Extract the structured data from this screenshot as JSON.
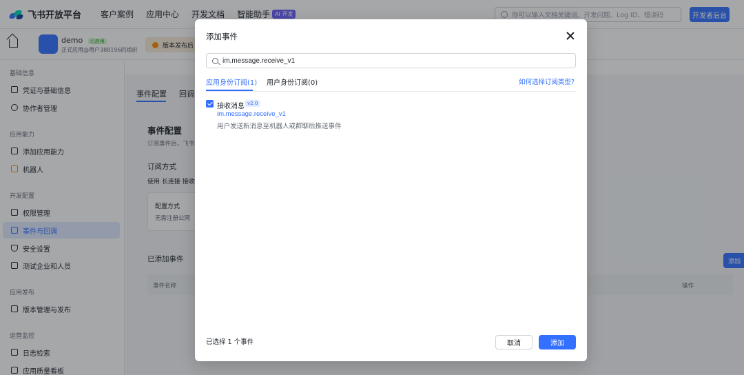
{
  "topnav": {
    "brand": "飞书开放平台",
    "items": [
      "客户案例",
      "应用中心",
      "开发文档",
      "智能助手"
    ],
    "ai_badge": "AI 开发",
    "search_placeholder": "你可以输入文档关键词、开发问题、Log ID、错误码",
    "dev_console": "开发者后台"
  },
  "subheader": {
    "app_name": "demo",
    "app_status": "已启用",
    "app_sub": "正式应用@用户388196的组织",
    "version_notice": "版本发布后"
  },
  "sidebar": {
    "groups": [
      {
        "label": "基础信息",
        "items": [
          "凭证与基础信息",
          "协作者管理"
        ]
      },
      {
        "label": "应用能力",
        "items": [
          "添加应用能力",
          "机器人"
        ]
      },
      {
        "label": "开发配置",
        "items": [
          "权限管理",
          "事件与回调",
          "安全设置",
          "测试企业和人员"
        ]
      },
      {
        "label": "应用发布",
        "items": [
          "版本管理与发布"
        ]
      },
      {
        "label": "运营监控",
        "items": [
          "日志检索",
          "应用质量看板"
        ]
      }
    ],
    "active_item": "事件与回调"
  },
  "main": {
    "tabs": [
      "事件配置",
      "回调"
    ],
    "section_title": "事件配置",
    "section_desc": "订阅事件后，飞书",
    "subscribe_label": "订阅方式",
    "subscribe_desc": "使用 长连接 接收",
    "config_label": "配置方式",
    "config_desc": "无需注册公网",
    "added_title": "已添加事件",
    "add_button": "添加",
    "col_name": "事件名称",
    "col_action": "操作"
  },
  "modal": {
    "title": "添加事件",
    "search_value": "im.message.receive_v1",
    "tabs": [
      "应用身份订阅(1)",
      "用户身份订阅(0)"
    ],
    "help_link": "如何选择订阅类型?",
    "event": {
      "name": "接收消息",
      "version": "v2.0",
      "key": "im.message.receive_v1",
      "description": "用户发送新消息至机器人或群聊后推送事件",
      "checked": true
    },
    "selected_text": "已选择 1 个事件",
    "cancel": "取消",
    "add": "添加"
  },
  "colors": {
    "primary": "#3370ff",
    "overlay": "rgba(31,35,41,0.40)"
  }
}
